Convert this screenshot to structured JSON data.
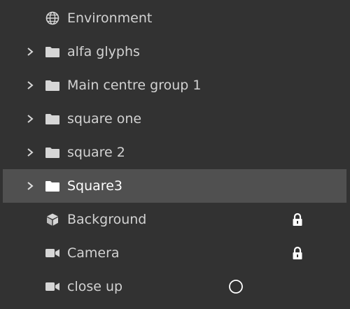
{
  "layers": [
    {
      "label": "Environment",
      "icon": "globe-icon",
      "expandable": false,
      "selected": false,
      "status": null
    },
    {
      "label": "alfa glyphs",
      "icon": "folder-icon",
      "expandable": true,
      "selected": false,
      "status": null
    },
    {
      "label": "Main centre group 1",
      "icon": "folder-icon",
      "expandable": true,
      "selected": false,
      "status": null
    },
    {
      "label": "square one",
      "icon": "folder-icon",
      "expandable": true,
      "selected": false,
      "status": null
    },
    {
      "label": "square 2",
      "icon": "folder-icon",
      "expandable": true,
      "selected": false,
      "status": null
    },
    {
      "label": "Square3",
      "icon": "folder-icon",
      "expandable": true,
      "selected": true,
      "status": null
    },
    {
      "label": "Background",
      "icon": "cube-icon",
      "expandable": false,
      "selected": false,
      "status": "lock-icon"
    },
    {
      "label": "Camera",
      "icon": "camera-icon",
      "expandable": false,
      "selected": false,
      "status": "lock-icon"
    },
    {
      "label": "close up",
      "icon": "camera-icon",
      "expandable": false,
      "selected": false,
      "status": "circle-icon"
    }
  ],
  "colors": {
    "background": "#323232",
    "selected_row": "#505050",
    "text": "#d2d2d2",
    "selected_text": "#ffffff"
  }
}
